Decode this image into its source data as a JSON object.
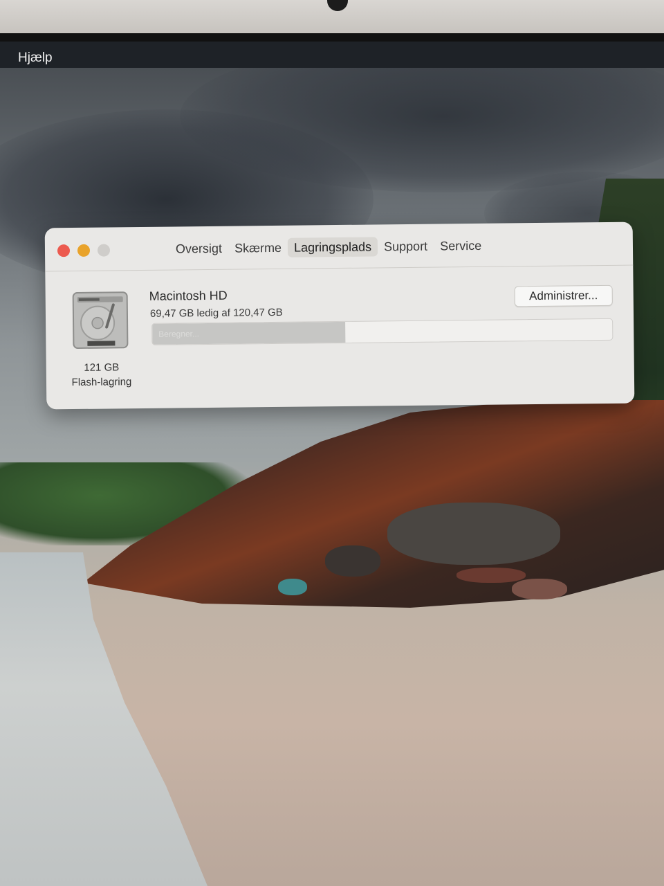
{
  "menubar": {
    "items": [
      "Hjælp"
    ]
  },
  "window": {
    "tabs": [
      {
        "label": "Oversigt",
        "active": false
      },
      {
        "label": "Skærme",
        "active": false
      },
      {
        "label": "Lagringsplads",
        "active": true
      },
      {
        "label": "Support",
        "active": false
      },
      {
        "label": "Service",
        "active": false
      }
    ],
    "disk": {
      "icon": "hard-drive-icon",
      "size_label": "121 GB",
      "type_label": "Flash-lagring"
    },
    "volume": {
      "name": "Macintosh HD",
      "free_text": "69,47 GB ledig af 120,47 GB",
      "usage_bar_status": "Beregner...",
      "used_fraction": 0.42
    },
    "manage_button": "Administrer..."
  },
  "colors": {
    "close": "#ec5a4f",
    "minimize": "#e9a32b",
    "zoom_disabled": "#cfcdca",
    "window_bg": "#e9e8e6",
    "menubar_bg": "#1e2227"
  }
}
